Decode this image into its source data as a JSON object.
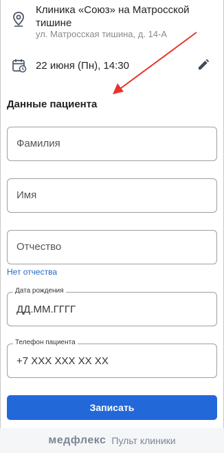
{
  "clinic": {
    "name": "Клиника «Союз» на Матросской тишине",
    "address": "ул. Матросская тишина, д. 14-А",
    "icon": "location-pin-icon"
  },
  "appointment": {
    "datetime": "22 июня (Пн), 14:30",
    "icon": "calendar-icon",
    "edit_icon": "pencil-icon"
  },
  "patient": {
    "title": "Данные пациента",
    "last_name_placeholder": "Фамилия",
    "first_name_placeholder": "Имя",
    "middle_name_placeholder": "Отчество",
    "no_middle_name_link": "Нет отчества",
    "birth_date_label": "Дата рождения",
    "birth_date_value": "ДД.ММ.ГГГГ",
    "phone_label": "Телефон пациента",
    "phone_value": "+7 XXX XXX XX XX"
  },
  "submit_label": "Записать",
  "footer": {
    "brand": "медфлекс",
    "caption": "Пульт клиники"
  },
  "colors": {
    "accent": "#2368d9",
    "link": "#2368c7",
    "annotation_arrow": "#e8322b"
  }
}
